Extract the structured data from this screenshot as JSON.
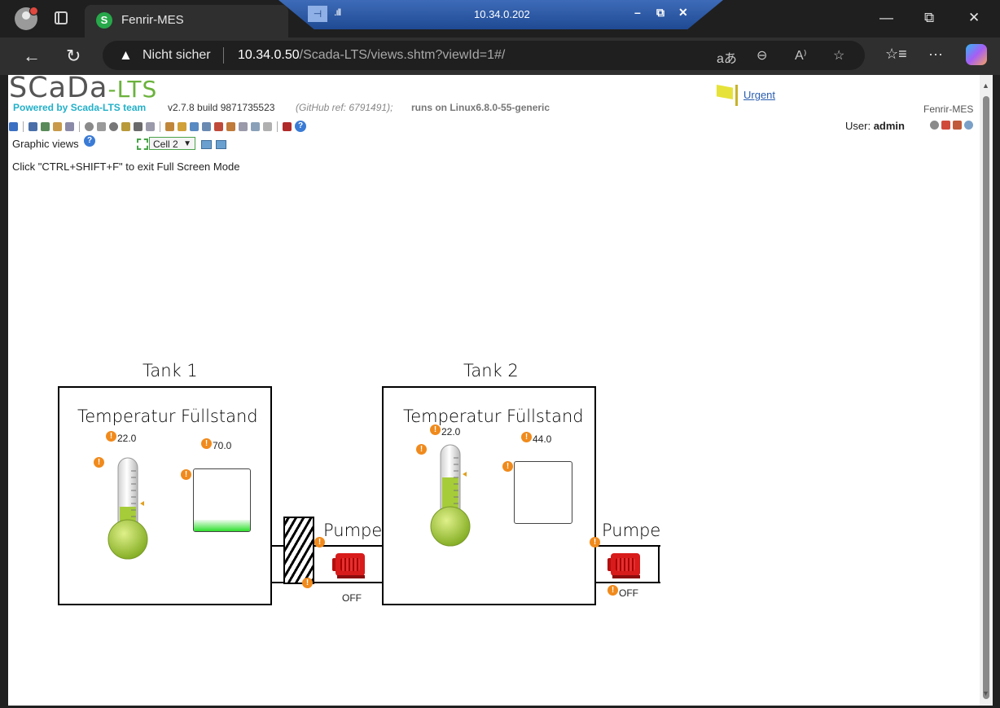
{
  "browser": {
    "tab_title": "Fenrir-MES",
    "tab_favicon": "S",
    "remote_session": {
      "title": "10.34.0.202",
      "signal": ".ıll",
      "pin": "⊣"
    },
    "security_label": "Nicht sicher",
    "url_host": "10.34.0.50",
    "url_path": "/Scada-LTS/views.shtm?viewId=1#/",
    "icons": [
      "back-icon",
      "refresh-icon",
      "read-aloud-icon",
      "zoom-icon",
      "immersive-reader-icon",
      "favorite-icon",
      "favorites-bar-icon",
      "more-icon",
      "copilot-icon"
    ]
  },
  "header": {
    "logo_main": "SCaDa",
    "logo_sep": "-",
    "logo_suffix": "LTS",
    "powered_by": "Powered by Scada-LTS team",
    "version": "v2.7.8 build 9871735523",
    "github_ref": "(GitHub ref: 6791491);",
    "runs_on": "runs on Linux6.8.0-55-generic",
    "alarm_link": "Urgent",
    "instance_name": "Fenrir-MES",
    "user_label": "User:",
    "user_name": "admin"
  },
  "graphic_views": {
    "label": "Graphic views",
    "selected_view": "Cell 2",
    "fullscreen_hint": "Click \"CTRL+SHIFT+F\" to exit Full Screen Mode"
  },
  "process": {
    "tank1": {
      "title": "Tank 1",
      "temp_label": "Temperatur",
      "temp_value": "22.0",
      "level_label": "Füllstand",
      "level_value": "70.0",
      "level_fill_fraction": 0.18
    },
    "tank2": {
      "title": "Tank 2",
      "temp_label": "Temperatur",
      "temp_value": "22.0",
      "level_label": "Füllstand",
      "level_value": "44.0",
      "level_fill_fraction": 0.0
    },
    "pump1": {
      "label": "Pumpe",
      "state": "OFF"
    },
    "pump2": {
      "label": "Pumpe",
      "state": "OFF"
    },
    "alarm_glyph": "!"
  },
  "colors": {
    "pump": "#d81b1b",
    "alarm": "#f08a1c",
    "level": "#2ee02e",
    "thermo_bulb": "#9ccc3a",
    "logo_accent": "#6bb23c",
    "powered_by": "#23b0c8"
  }
}
